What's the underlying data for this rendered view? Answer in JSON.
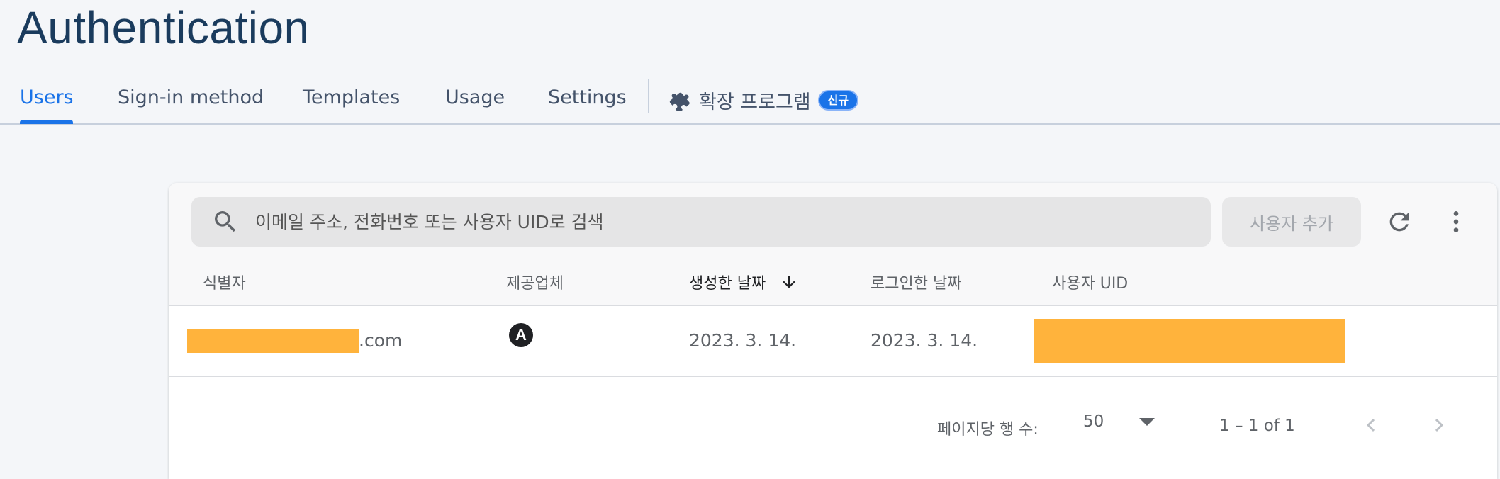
{
  "page": {
    "title": "Authentication"
  },
  "tabs": [
    {
      "label": "Users",
      "active": true
    },
    {
      "label": "Sign-in method",
      "active": false
    },
    {
      "label": "Templates",
      "active": false
    },
    {
      "label": "Usage",
      "active": false
    },
    {
      "label": "Settings",
      "active": false
    }
  ],
  "extensions_tab": {
    "label": "확장 프로그램",
    "badge": "신규",
    "icon": "puzzle-piece-icon"
  },
  "toolbar": {
    "search_placeholder": "이메일 주소, 전화번호 또는 사용자 UID로 검색",
    "search_icon": "search-icon",
    "add_user_label": "사용자 추가",
    "refresh_icon": "refresh-icon",
    "more_icon": "more-vert-icon"
  },
  "table": {
    "columns": [
      {
        "label": "식별자"
      },
      {
        "label": "제공업체"
      },
      {
        "label": "생성한 날짜",
        "sorted": "desc"
      },
      {
        "label": "로그인한 날짜"
      },
      {
        "label": "사용자 UID"
      }
    ],
    "rows": [
      {
        "identifier_visible": ".com",
        "provider_glyph": "A",
        "created": "2023. 3. 14.",
        "signed_in": "2023. 3. 14."
      }
    ]
  },
  "pagination": {
    "rows_per_page_label": "페이지당 행 수:",
    "rows_per_page": "50",
    "range": "1 – 1 of 1"
  },
  "colors": {
    "accent": "#1a73e8",
    "title": "#1a3b5d",
    "redaction": "#ffb33c",
    "background": "#f4f6f9"
  }
}
